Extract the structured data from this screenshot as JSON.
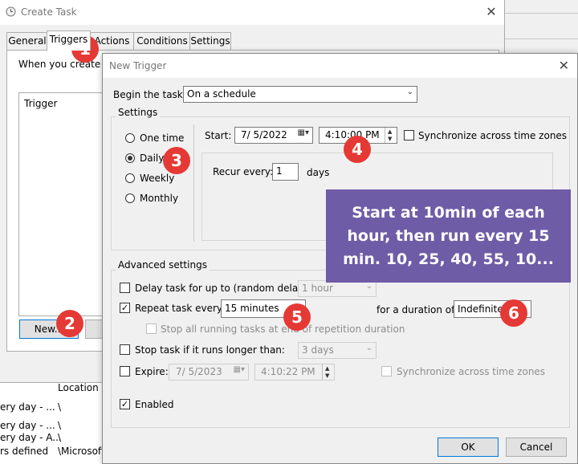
{
  "create_task": {
    "title": "Create Task",
    "tabs": [
      "General",
      "Triggers",
      "Actions",
      "Conditions",
      "Settings"
    ],
    "description": "When you create a task, you can specify the conditions that will trigger the task.",
    "trigger_list_header": "Trigger",
    "new_button": "New...",
    "close_glyph": "✕"
  },
  "background_list": {
    "header": "Location",
    "rows": [
      {
        "c1": "ery day - ...",
        "c2": "\\"
      },
      {
        "c1": "ery day - ...",
        "c2": "\\"
      },
      {
        "c1": "ery day - A...",
        "c2": "\\"
      },
      {
        "c1": "rs defined",
        "c2": "\\Microsoft"
      }
    ]
  },
  "new_trigger": {
    "title": "New Trigger",
    "close_glyph": "✕",
    "begin_label": "Begin the task:",
    "begin_value": "On a schedule",
    "settings_group": "Settings",
    "radios": [
      "One time",
      "Daily",
      "Weekly",
      "Monthly"
    ],
    "selected_radio": "Daily",
    "start_label": "Start:",
    "start_date": "7/ 5/2022",
    "start_time": "4:10:00 PM",
    "sync_label": "Synchronize across time zones",
    "recur_label": "Recur every:",
    "recur_value": "1",
    "recur_unit": "days",
    "advanced_group": "Advanced settings",
    "delay_label": "Delay task for up to (random delay):",
    "delay_value": "1 hour",
    "repeat_label": "Repeat task every:",
    "repeat_value": "15 minutes",
    "duration_label": "for a duration of:",
    "duration_value": "Indefinitely",
    "stop_running_label": "Stop all running tasks at end of repetition duration",
    "stop_longer_label": "Stop task if it runs longer than:",
    "stop_longer_value": "3 days",
    "expire_label": "Expire:",
    "expire_date": "7/ 5/2023",
    "expire_time": "4:10:22 PM",
    "expire_sync_label": "Synchronize across time zones",
    "enabled_label": "Enabled",
    "ok_button": "OK",
    "cancel_button": "Cancel"
  },
  "annotations": {
    "badges": [
      "1",
      "2",
      "3",
      "4",
      "5",
      "6"
    ],
    "callout_lines": [
      "Start at 10min of each",
      "hour, then run every 15",
      "min. 10, 25, 40, 55, 10..."
    ]
  },
  "colors": {
    "badge": "#e53935",
    "callout": "#6f5ca6",
    "focus": "#0078d7"
  }
}
